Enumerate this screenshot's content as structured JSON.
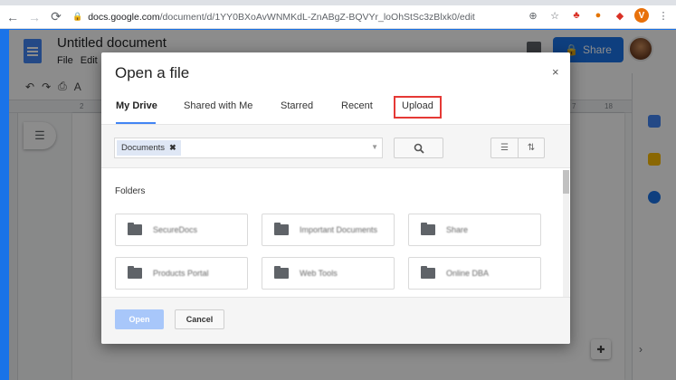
{
  "browser": {
    "url_host": "docs.google.com",
    "url_path": "/document/d/1YY0BXoAvWNMKdL-ZnABgZ-BQVYr_loOhStSc3zBlxk0/edit",
    "avatar_letter": "V"
  },
  "docs": {
    "title": "Untitled document",
    "menu": [
      "File",
      "Edit"
    ],
    "share_label": "Share",
    "ruler_numbers": [
      "2",
      "7",
      "18"
    ]
  },
  "dialog": {
    "title": "Open a file",
    "close": "×",
    "tabs": [
      {
        "label": "My Drive"
      },
      {
        "label": "Shared with Me"
      },
      {
        "label": "Starred"
      },
      {
        "label": "Recent"
      },
      {
        "label": "Upload"
      }
    ],
    "active_tab": "My Drive",
    "search_chip": "Documents",
    "section_label": "Folders",
    "folders": [
      {
        "name": "SecureDocs"
      },
      {
        "name": "Important Documents"
      },
      {
        "name": "Share"
      },
      {
        "name": "Products Portal"
      },
      {
        "name": "Web Tools"
      },
      {
        "name": "Online DBA"
      }
    ],
    "open_label": "Open",
    "cancel_label": "Cancel"
  },
  "colors": {
    "accent": "#1a73e8",
    "tab_underline": "#4285f4",
    "highlight": "#e53935",
    "open_disabled": "#a8c7fa"
  }
}
